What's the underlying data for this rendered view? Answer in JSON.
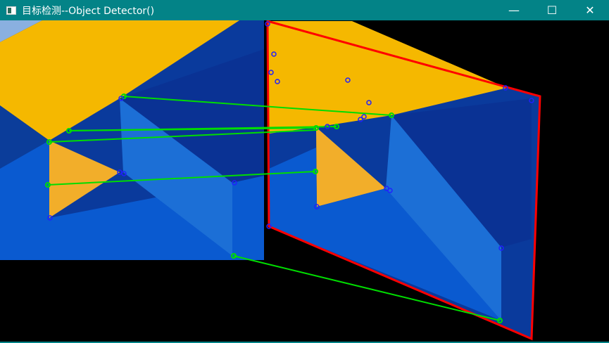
{
  "window": {
    "title": "目标检测--Object Detector()",
    "minimize": "—",
    "maximize": "☐",
    "close": "✕"
  },
  "colors": {
    "titlebar": "#038387",
    "match_line": "#00dd00",
    "keypoint": "#2020ff",
    "outline": "#ff0000"
  }
}
